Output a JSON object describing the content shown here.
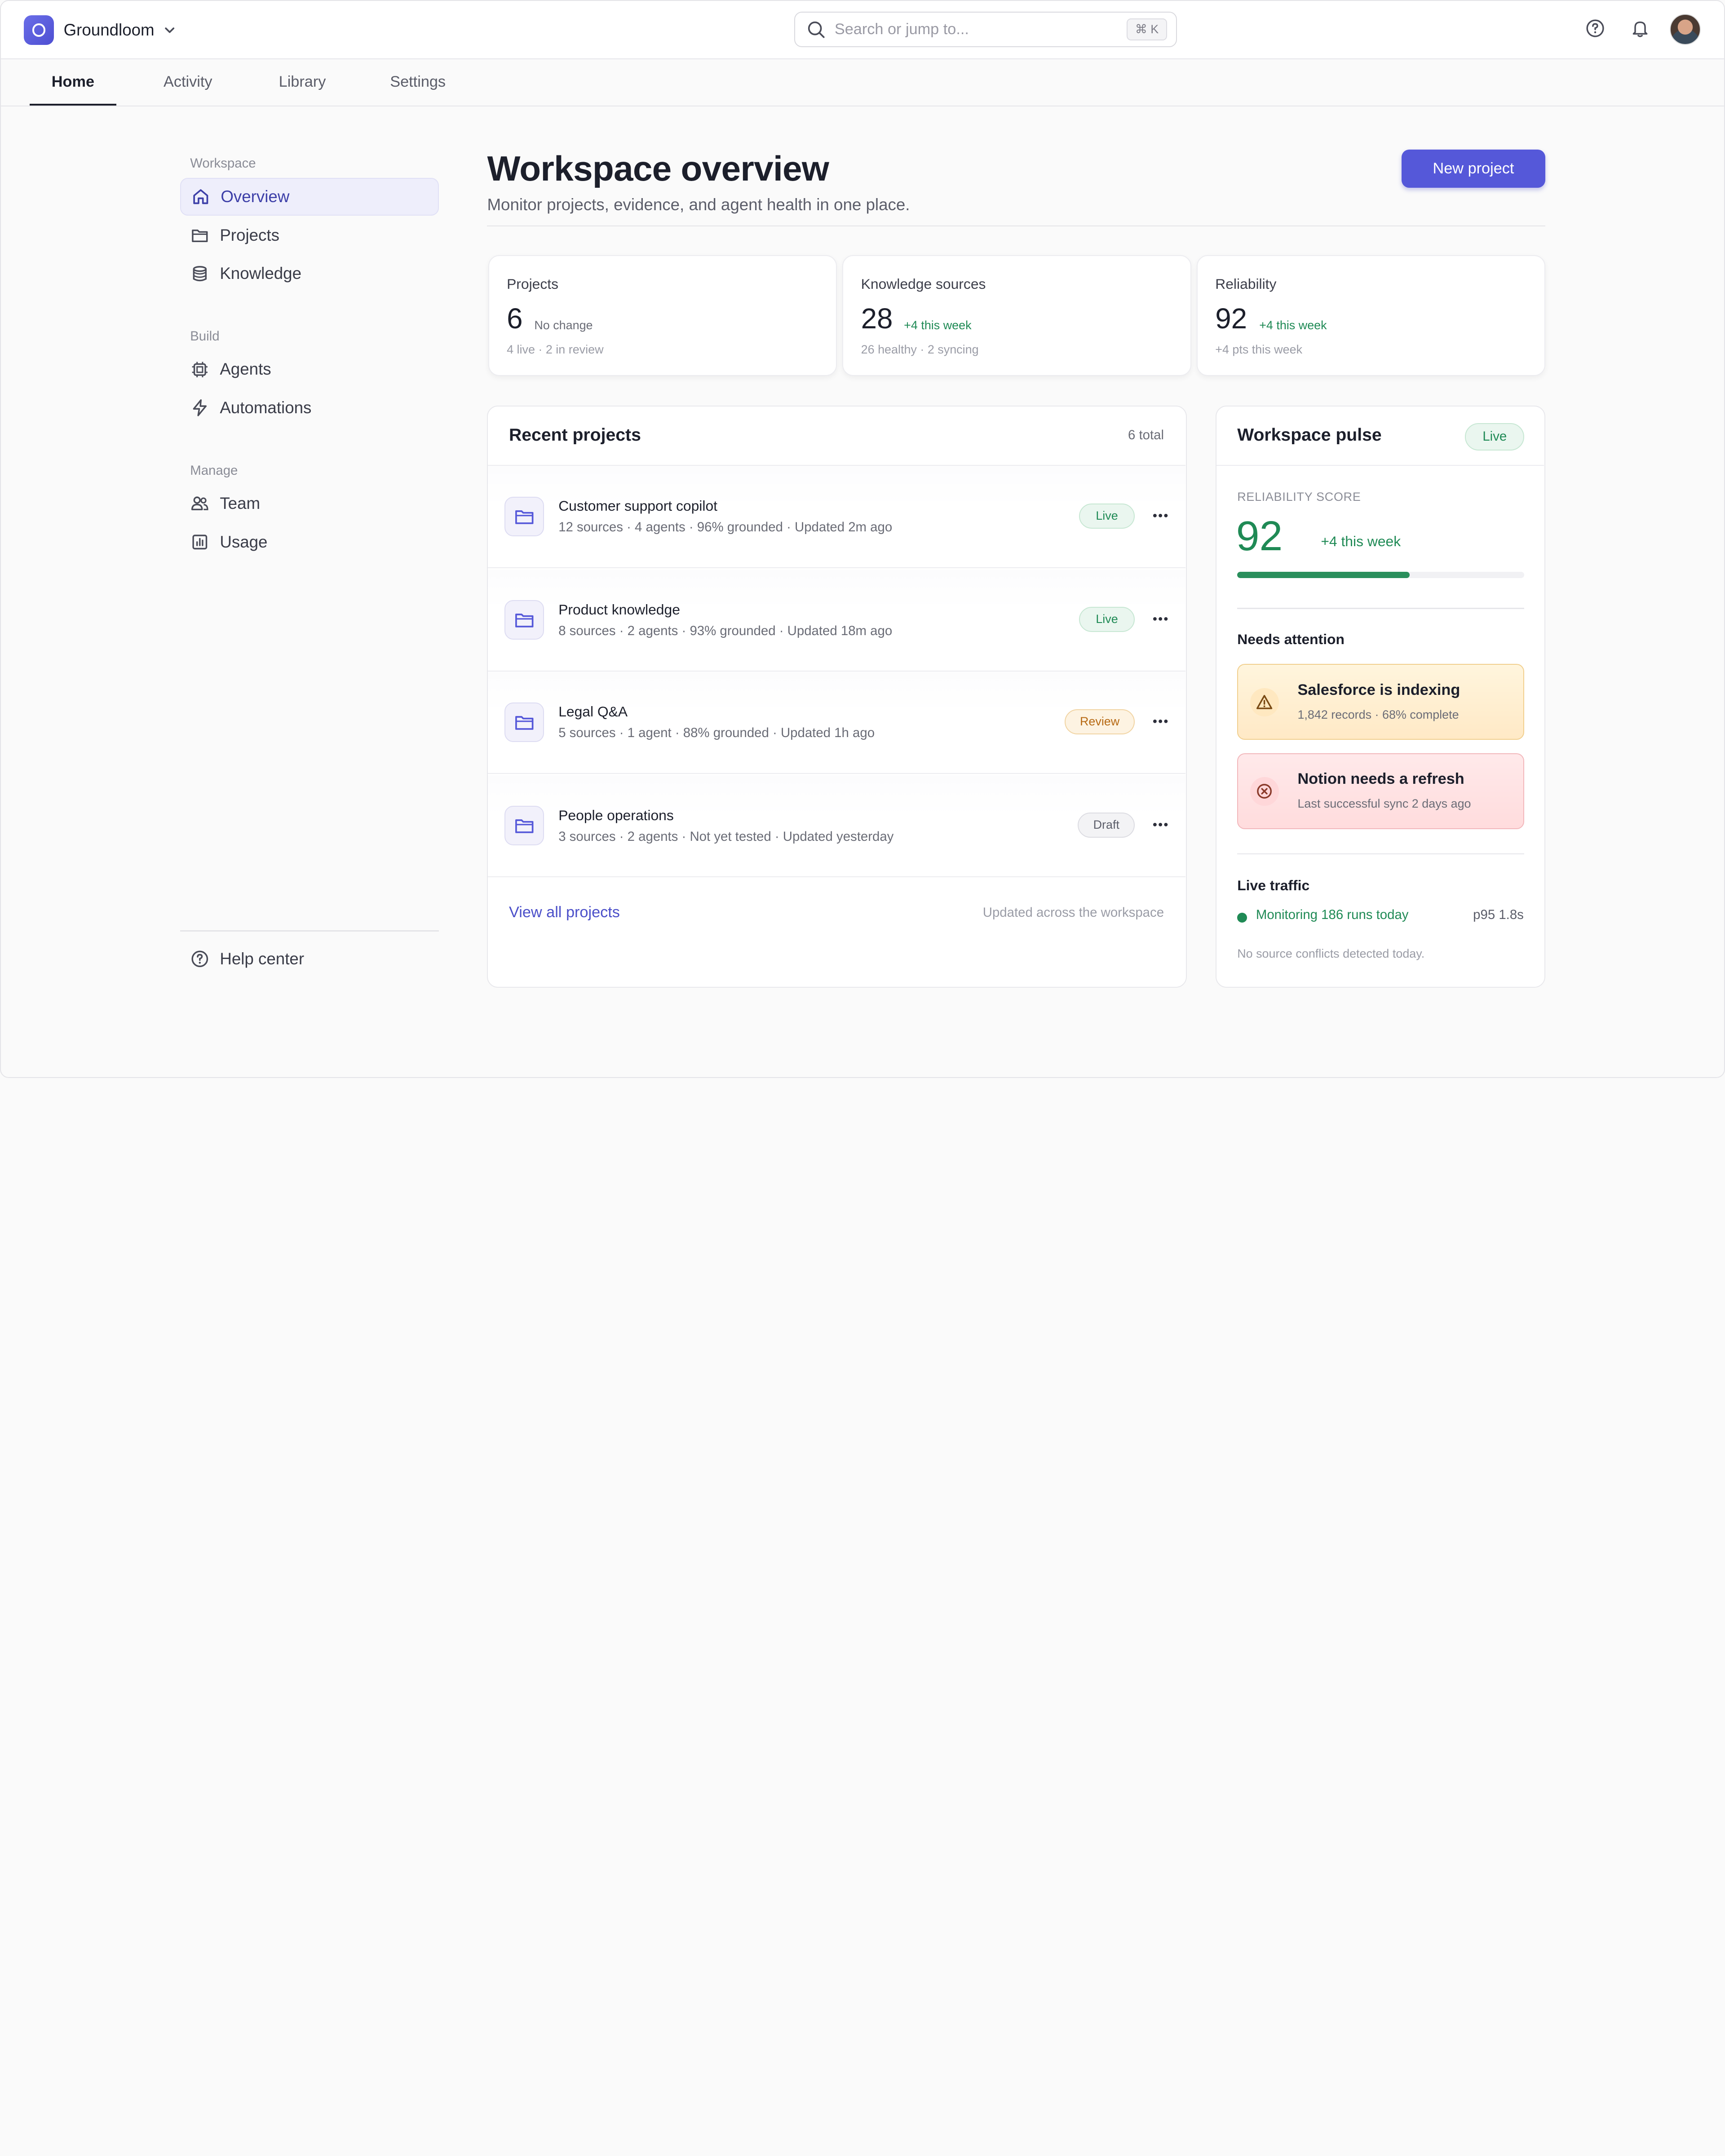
{
  "app": {
    "name": "Groundloom"
  },
  "search": {
    "placeholder": "Search or jump to...",
    "shortcut": "⌘ K"
  },
  "tabs": [
    {
      "label": "Home",
      "active": true
    },
    {
      "label": "Activity",
      "active": false
    },
    {
      "label": "Library",
      "active": false
    },
    {
      "label": "Settings",
      "active": false
    }
  ],
  "sidebar": {
    "groups": [
      {
        "label": "Workspace",
        "items": [
          {
            "label": "Overview",
            "icon": "home-icon",
            "active": true
          },
          {
            "label": "Projects",
            "icon": "folder-icon"
          },
          {
            "label": "Knowledge",
            "icon": "database-icon"
          }
        ]
      },
      {
        "label": "Build",
        "items": [
          {
            "label": "Agents",
            "icon": "chip-icon"
          },
          {
            "label": "Automations",
            "icon": "lightning-icon"
          }
        ]
      },
      {
        "label": "Manage",
        "items": [
          {
            "label": "Team",
            "icon": "users-icon"
          },
          {
            "label": "Usage",
            "icon": "bar-chart-icon"
          }
        ]
      }
    ],
    "help": {
      "label": "Help center",
      "icon": "help-circle-icon"
    }
  },
  "header": {
    "title": "Workspace overview",
    "subtitle": "Monitor projects, evidence, and agent health in one place.",
    "new_button": "New project"
  },
  "stats": [
    {
      "label": "Projects",
      "value": "6",
      "delta": "No change",
      "delta_positive": false,
      "footnote": "4 live · 2 in review"
    },
    {
      "label": "Knowledge sources",
      "value": "28",
      "delta": "+4 this week",
      "delta_positive": true,
      "footnote": "26 healthy · 2 syncing"
    },
    {
      "label": "Reliability",
      "value": "92",
      "delta": "+4 this week",
      "delta_positive": true,
      "footnote": "+4 pts this week"
    }
  ],
  "recent_projects": {
    "title": "Recent projects",
    "total": "6 total",
    "rows": [
      {
        "name": "Customer support copilot",
        "meta": "12 sources · 4 agents · 96% grounded · Updated 2m ago",
        "status": "Live"
      },
      {
        "name": "Product knowledge",
        "meta": "8 sources · 2 agents · 93% grounded · Updated 18m ago",
        "status": "Live"
      },
      {
        "name": "Legal Q&A",
        "meta": "5 sources · 1 agent · 88% grounded · Updated 1h ago",
        "status": "Review"
      },
      {
        "name": "People operations",
        "meta": "3 sources · 2 agents · Not yet tested · Updated yesterday",
        "status": "Draft"
      }
    ],
    "view_all": "View all projects",
    "footnote": "Updated across the workspace"
  },
  "pulse": {
    "title": "Workspace pulse",
    "badge": "Live",
    "reliability_label": "RELIABILITY SCORE",
    "reliability_score": "92",
    "reliability_delta": "+4 this week",
    "reliability_fraction": 0.6,
    "needs_attention_title": "Needs attention",
    "alerts": [
      {
        "kind": "warning",
        "title": "Salesforce is indexing",
        "subtitle": "1,842 records · 68% complete"
      },
      {
        "kind": "error",
        "title": "Notion needs a refresh",
        "subtitle": "Last successful sync 2 days ago"
      }
    ],
    "live_traffic_title": "Live traffic",
    "traffic_text": "Monitoring 186 runs today",
    "p95": "p95 1.8s",
    "footnote": "No source conflicts detected today."
  },
  "colors": {
    "accent": "#5558d9",
    "success": "#1f8a55",
    "warning": "#b76a14",
    "error": "#c0392b"
  }
}
